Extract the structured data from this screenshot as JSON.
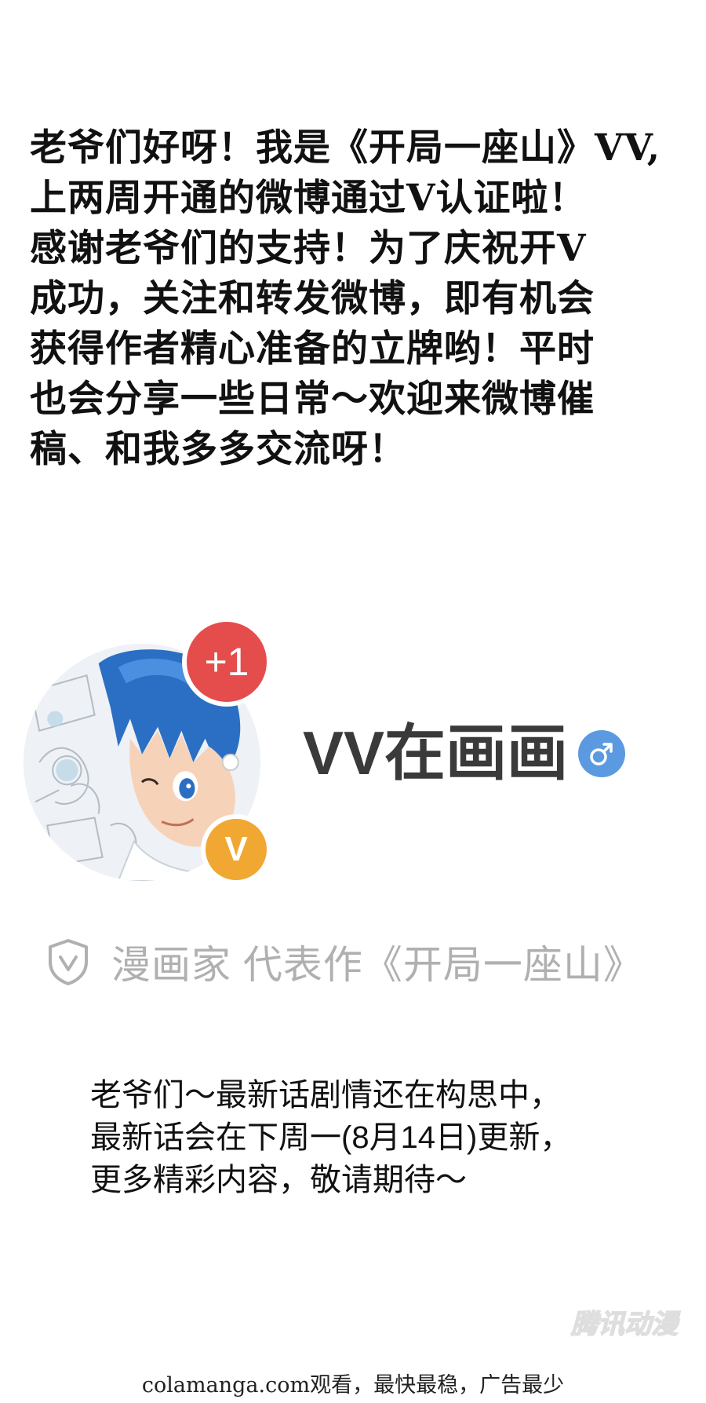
{
  "announcement": {
    "lines": [
      "老爷们好呀！我是《开局一座山》VV,",
      "上两周开通的微博通过V认证啦！",
      "感谢老爷们的支持！为了庆祝开V",
      "成功，关注和转发微博，即有机会",
      "获得作者精心准备的立牌哟！平时",
      "也会分享一些日常～欢迎来微博催",
      "稿、和我多多交流呀！"
    ]
  },
  "profile": {
    "notification_badge": "+1",
    "verified_badge": "V",
    "username": "VV在画画",
    "gender_icon": "male-icon",
    "verification_icon": "shield-v-icon",
    "verification_text": "漫画家 代表作《开局一座山》",
    "colors": {
      "notification": "#e54c4c",
      "verified": "#f0a832",
      "gender": "#5b9ae0",
      "muted_text": "#b0b0b0"
    }
  },
  "update_notice": {
    "lines": [
      "老爷们～最新话剧情还在构思中，",
      "最新话会在下周一(8月14日)更新，",
      "更多精彩内容，敬请期待～"
    ]
  },
  "watermark": "腾讯动漫",
  "footer": "colamanga.com观看，最快最稳，广告最少"
}
